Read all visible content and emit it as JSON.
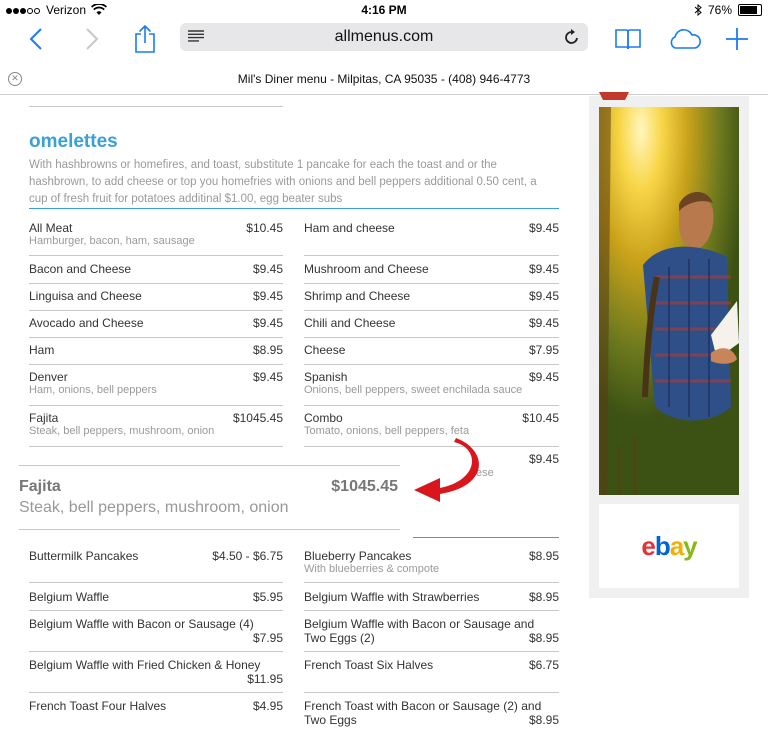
{
  "status": {
    "carrier": "Verizon",
    "time": "4:16 PM",
    "battery": "76%",
    "battery_level": 0.76
  },
  "toolbar": {
    "url": "allmenus.com"
  },
  "page": {
    "title": "Mil's Diner menu - Milpitas, CA 95035 - (408) 946-4773"
  },
  "menu": {
    "section_title": "omelettes",
    "section_desc": "With hashbrowns or homefires, and toast, substitute 1 pancake for each the toast and or the hashbrown, to add cheese or top you homefries with onions and bell peppers additional 0.50 cent, a cup of fresh fruit for potatoes additinal $1.00, egg beater subs",
    "omelettes_left": [
      {
        "name": "All Meat",
        "price": "$10.45",
        "desc": "Hamburger, bacon, ham, sausage"
      },
      {
        "name": "Bacon and Cheese",
        "price": "$9.45",
        "desc": ""
      },
      {
        "name": "Linguisa and Cheese",
        "price": "$9.45",
        "desc": ""
      },
      {
        "name": "Avocado and Cheese",
        "price": "$9.45",
        "desc": ""
      },
      {
        "name": "Ham",
        "price": "$8.95",
        "desc": ""
      },
      {
        "name": "Denver",
        "price": "$9.45",
        "desc": "Ham, onions, bell peppers"
      },
      {
        "name": "Fajita",
        "price": "$1045.45",
        "desc": "Steak, bell peppers, mushroom, onion"
      }
    ],
    "omelettes_right": [
      {
        "name": "Ham and cheese",
        "price": "$9.45",
        "desc": ""
      },
      {
        "name": "Mushroom and Cheese",
        "price": "$9.45",
        "desc": ""
      },
      {
        "name": "Shrimp and Cheese",
        "price": "$9.45",
        "desc": ""
      },
      {
        "name": "Chili and Cheese",
        "price": "$9.45",
        "desc": ""
      },
      {
        "name": "Cheese",
        "price": "$7.95",
        "desc": ""
      },
      {
        "name": "Spanish",
        "price": "$9.45",
        "desc": "Onions, bell peppers, sweet enchilada sauce"
      },
      {
        "name": "Combo",
        "price": "$10.45",
        "desc": "Tomato, onions, bell peppers, feta"
      },
      {
        "name": "",
        "price": "$9.45",
        "desc": ""
      }
    ],
    "peek_text": "ese",
    "zoomed": {
      "name": "Fajita",
      "price": "$1045.45",
      "desc": "Steak, bell peppers, mushroom, onion"
    },
    "pancakes_left": [
      {
        "name": "Buttermilk Pancakes",
        "price": "$4.50 - $6.75",
        "desc": ""
      },
      {
        "name": "Belgium Waffle",
        "price": "$5.95",
        "desc": ""
      },
      {
        "name": "Belgium Waffle with Bacon or Sausage (4)",
        "price": "$7.95",
        "desc": ""
      },
      {
        "name": "Belgium Waffle with Fried Chicken & Honey",
        "price": "$11.95",
        "desc": ""
      },
      {
        "name": "French Toast Four Halves",
        "price": "$4.95",
        "desc": ""
      }
    ],
    "pancakes_right": [
      {
        "name": "Blueberry Pancakes",
        "price": "$8.95",
        "desc": "With blueberries & compote"
      },
      {
        "name": "Belgium Waffle with Strawberries",
        "price": "$8.95",
        "desc": ""
      },
      {
        "name": "Belgium Waffle with Bacon or Sausage and Two Eggs (2)",
        "price": "$8.95",
        "desc": ""
      },
      {
        "name": "French Toast Six Halves",
        "price": "$6.75",
        "desc": ""
      },
      {
        "name": "French Toast with Bacon or Sausage (2) and Two Eggs",
        "price": "$8.95",
        "desc": ""
      }
    ]
  },
  "ad": {
    "brand_letters": [
      "e",
      "b",
      "a",
      "y"
    ],
    "brand_colors": [
      "#e53238",
      "#0064d2",
      "#f5af02",
      "#86b817"
    ]
  },
  "colors": {
    "accent": "#3aa0d6",
    "ios_blue": "#1a7cf5",
    "arrow_red": "#d8161b"
  }
}
